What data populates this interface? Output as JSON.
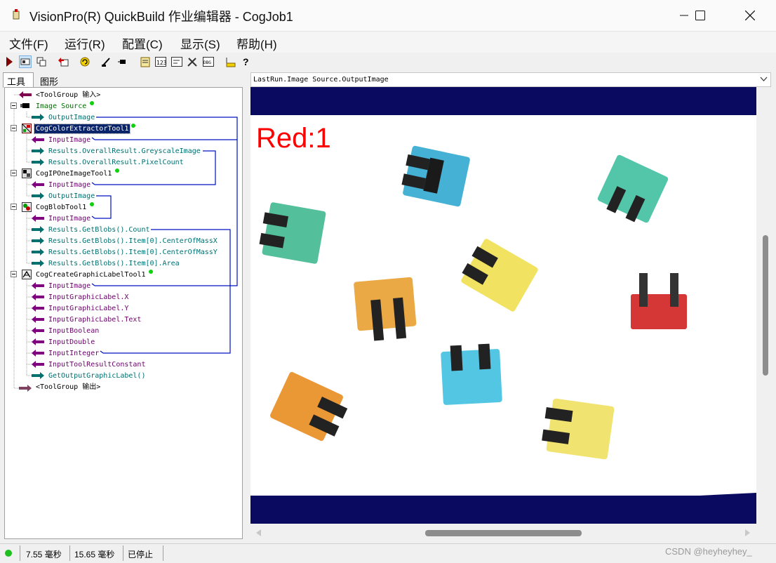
{
  "window": {
    "title": "VisionPro(R) QuickBuild 作业编辑器 - CogJob1"
  },
  "menu": [
    "文件(F)",
    "运行(R)",
    "配置(C)",
    "显示(S)",
    "帮助(H)"
  ],
  "tabs": [
    "工具",
    "图形"
  ],
  "tree": {
    "tool_group_in": "<ToolGroup 输入>",
    "image_source": "Image Source",
    "image_source_output": "OutputImage",
    "color_tool": "CogColorExtractorTool1",
    "color_in": "InputImage",
    "color_out1": "Results.OverallResult.GreyscaleImage",
    "color_out2": "Results.OverallResult.PixelCount",
    "ip_tool": "CogIPOneImageTool1",
    "ip_in": "InputImage",
    "ip_out": "OutputImage",
    "blob_tool": "CogBlobTool1",
    "blob_in": "InputImage",
    "blob_out1": "Results.GetBlobs().Count",
    "blob_out2": "Results.GetBlobs().Item[0].CenterOfMassX",
    "blob_out3": "Results.GetBlobs().Item[0].CenterOfMassY",
    "blob_out4": "Results.GetBlobs().Item[0].Area",
    "label_tool": "CogCreateGraphicLabelTool1",
    "label_in1": "InputImage",
    "label_in2": "InputGraphicLabel.X",
    "label_in3": "InputGraphicLabel.Y",
    "label_in4": "InputGraphicLabel.Text",
    "label_in5": "InputBoolean",
    "label_in6": "InputDouble",
    "label_in7": "InputInteger",
    "label_in8": "InputToolResultConstant",
    "label_out": "GetOutputGraphicLabel()",
    "tool_group_out": "<ToolGroup 输出>"
  },
  "image_view": {
    "selector": "LastRun.Image Source.OutputImage",
    "overlay_label": "Red:1"
  },
  "status": {
    "time1": "7.55 毫秒",
    "time2": "15.65 毫秒",
    "state": "已停止"
  },
  "watermark": "CSDN @heyheyhey_",
  "colors": {
    "overlay_red": "#ff0000",
    "link_blue": "#0010c0",
    "band_navy": "#0a0a60"
  }
}
